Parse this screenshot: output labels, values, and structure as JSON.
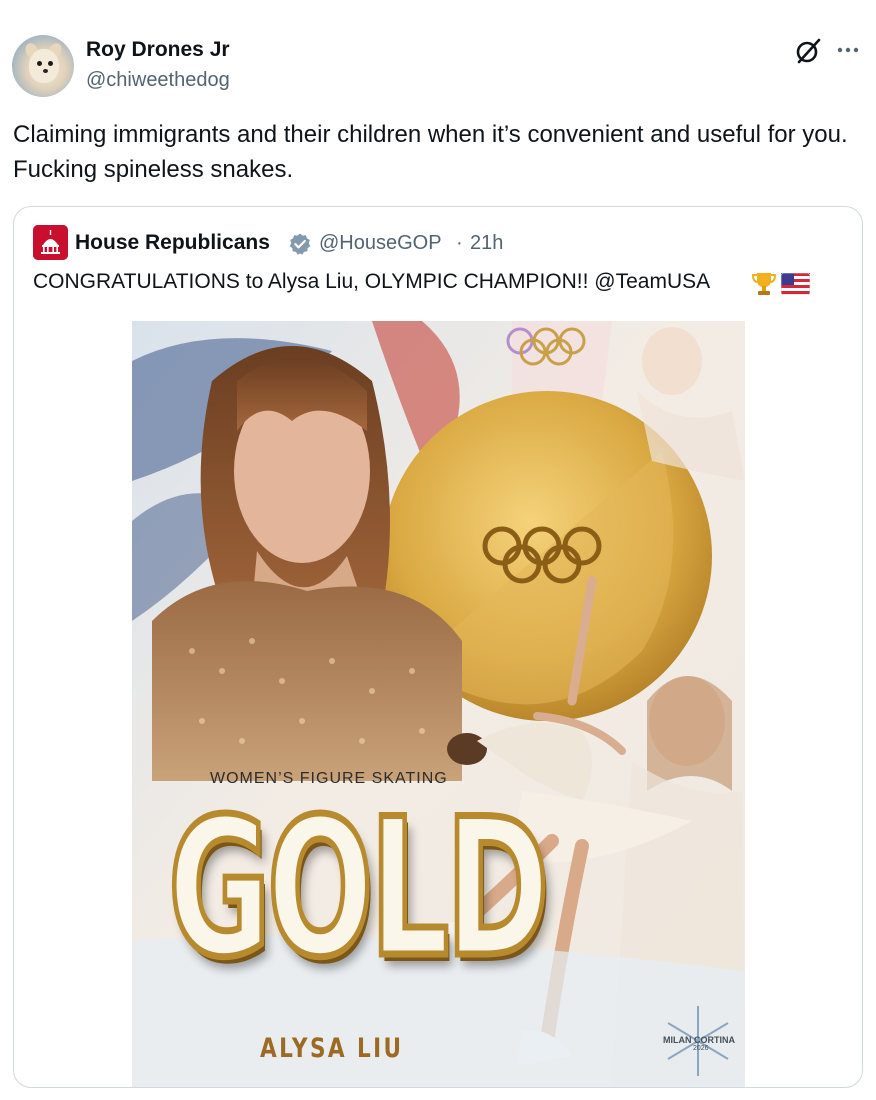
{
  "author": {
    "display_name": "Roy Drones Jr",
    "handle": "@chiweethedog",
    "avatar_icon": "chihuahua-avatar"
  },
  "actions": {
    "grok_icon": "grok-icon",
    "more_icon": "more-icon"
  },
  "tweet": {
    "text": "Claiming immigrants and their children when it’s convenient and useful for you. Fucking spineless snakes."
  },
  "quoted": {
    "display_name": "House Republicans",
    "verified": true,
    "verified_color": "#829aab",
    "handle": "@HouseGOP",
    "separator": "·",
    "time": "21h",
    "text": "CONGRATULATIONS to Alysa Liu, OLYMPIC CHAMPION!! @TeamUSA",
    "emojis": [
      "trophy-emoji",
      "us-flag-emoji"
    ],
    "brand_color": "#c8102e",
    "image": {
      "subtitle": "WOMEN’S FIGURE SKATING",
      "headline": "GOLD",
      "athlete": "ALYSA LIU",
      "brand": "MILAN CORTINA",
      "year": "2026"
    }
  },
  "colors": {
    "text": "#0f1419",
    "secondary": "#536471",
    "border": "#cfd9de",
    "gold": "#c9a04a"
  }
}
